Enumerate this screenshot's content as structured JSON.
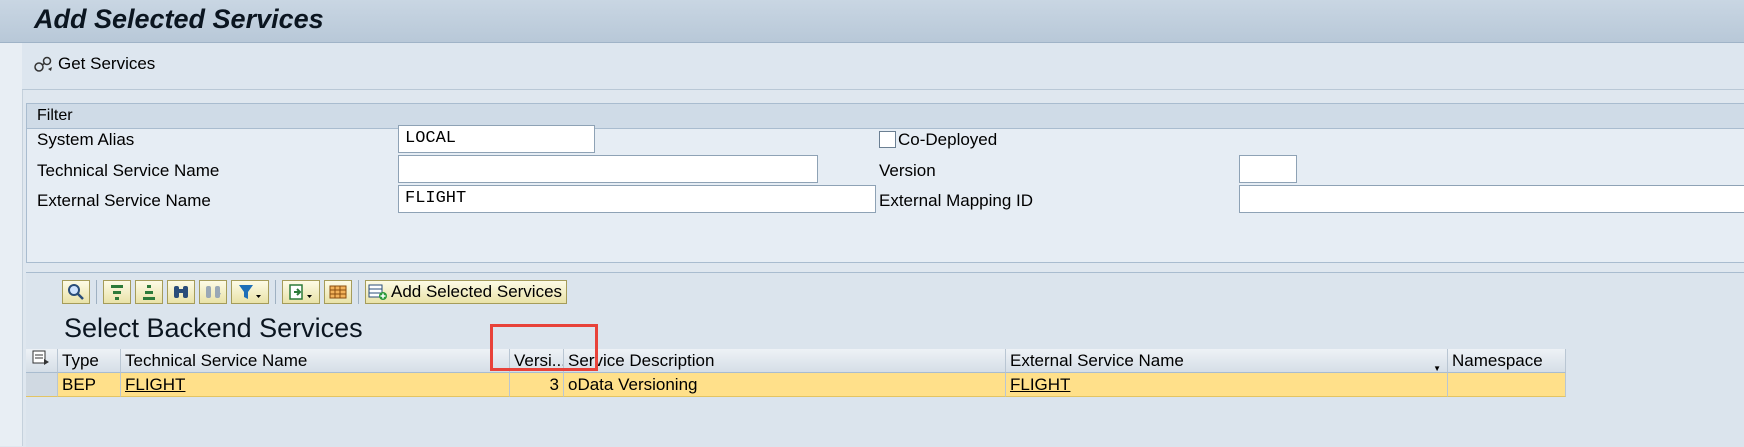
{
  "window": {
    "title": "Add Selected Services"
  },
  "toolbar": {
    "get_services_label": "Get Services"
  },
  "filter": {
    "header": "Filter",
    "system_alias_label": "System Alias",
    "system_alias_value": "LOCAL",
    "technical_service_name_label": "Technical Service Name",
    "technical_service_name_value": "",
    "external_service_name_label": "External Service Name",
    "external_service_name_value": "FLIGHT",
    "co_deployed_label": "Co-Deployed",
    "version_label": "Version",
    "version_value": "",
    "external_mapping_id_label": "External Mapping ID",
    "external_mapping_id_value": ""
  },
  "alv": {
    "add_selected_label": "Add Selected Services",
    "section_title": "Select Backend Services",
    "columns": {
      "type": "Type",
      "technical_service_name": "Technical Service Name",
      "version": "Versi...",
      "service_description": "Service Description",
      "external_service_name": "External Service Name",
      "namespace": "Namespace"
    },
    "rows": [
      {
        "type": "BEP",
        "technical_service_name": "FLIGHT",
        "version": "3",
        "service_description": "oData Versioning",
        "external_service_name": "FLIGHT",
        "namespace": ""
      }
    ]
  },
  "colors": {
    "selected_row": "#ffe08a",
    "highlight_box": "#e8423a",
    "background": "#dfe7ef"
  }
}
